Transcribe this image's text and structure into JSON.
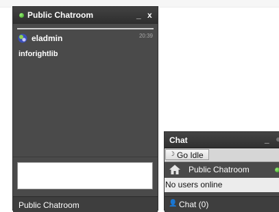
{
  "chatroom": {
    "title": "Public Chatroom",
    "minimize": "_",
    "close": "x",
    "messages": [
      {
        "user": "eladmin",
        "time": "20:39",
        "text": "inforightlib",
        "avatar_icon": "user-avatar-icon"
      }
    ],
    "input_value": "",
    "footer_label": "Public Chatroom"
  },
  "chat_panel": {
    "title": "Chat",
    "minimize": "_",
    "idle_button": "Go Idle",
    "room": {
      "name": "Public Chatroom",
      "icon": "home-icon",
      "status_color": "#3aa820"
    },
    "users_text": "No users online",
    "footer_label": "Chat (0)",
    "footer_icon": "people-icon"
  },
  "colors": {
    "window_bg": "#4a4a4a",
    "titlebar": "#363636",
    "status_online": "#3aa820",
    "text": "#ffffff"
  }
}
